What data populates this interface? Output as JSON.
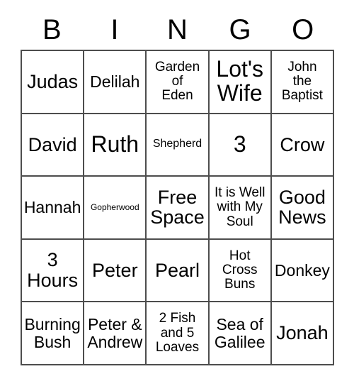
{
  "card": {
    "header": {
      "letters": [
        "B",
        "I",
        "N",
        "G",
        "O"
      ]
    },
    "rows": [
      [
        {
          "text": "Judas",
          "size": "lg"
        },
        {
          "text": "Delilah",
          "size": "md"
        },
        {
          "text": "Garden\nof\nEden",
          "size": "sm"
        },
        {
          "text": "Lot's\nWife",
          "size": "xl"
        },
        {
          "text": "John\nthe\nBaptist",
          "size": "sm"
        }
      ],
      [
        {
          "text": "David",
          "size": "lg"
        },
        {
          "text": "Ruth",
          "size": "xl"
        },
        {
          "text": "Shepherd",
          "size": "xs"
        },
        {
          "text": "3",
          "size": "xl"
        },
        {
          "text": "Crow",
          "size": "lg"
        }
      ],
      [
        {
          "text": "Hannah",
          "size": "md"
        },
        {
          "text": "Gopherwood",
          "size": "xxs"
        },
        {
          "text": "Free\nSpace",
          "size": "lg"
        },
        {
          "text": "It is Well\nwith My\nSoul",
          "size": "sm"
        },
        {
          "text": "Good\nNews",
          "size": "lg"
        }
      ],
      [
        {
          "text": "3\nHours",
          "size": "lg"
        },
        {
          "text": "Peter",
          "size": "lg"
        },
        {
          "text": "Pearl",
          "size": "lg"
        },
        {
          "text": "Hot\nCross\nBuns",
          "size": "sm"
        },
        {
          "text": "Donkey",
          "size": "md"
        }
      ],
      [
        {
          "text": "Burning\nBush",
          "size": "md"
        },
        {
          "text": "Peter &\nAndrew",
          "size": "md"
        },
        {
          "text": "2 Fish\nand 5\nLoaves",
          "size": "sm"
        },
        {
          "text": "Sea of\nGalilee",
          "size": "md"
        },
        {
          "text": "Jonah",
          "size": "lg"
        }
      ]
    ]
  },
  "colors": {
    "border": "#4d4d4d",
    "text": "#000000",
    "background": "#ffffff"
  }
}
